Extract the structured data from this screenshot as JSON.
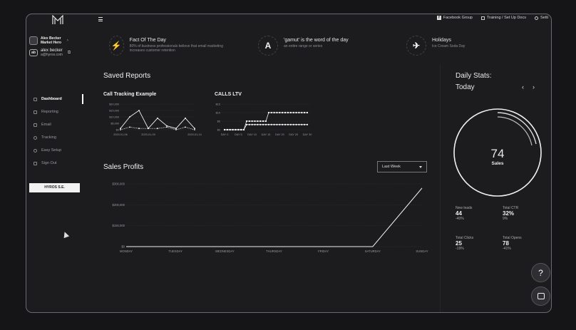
{
  "topbar": {
    "links": [
      {
        "label": "Facebook Group",
        "icon": "facebook-icon"
      },
      {
        "label": "Training / Set Up Docs",
        "icon": "book-icon"
      },
      {
        "label": "Setti",
        "icon": "gear-icon"
      }
    ]
  },
  "sidebar": {
    "account_name_line1": "Alex Becker",
    "account_name_line2": "Market Hero",
    "user_initials": "ab",
    "user_name": "alex becker",
    "user_email": "a@hyros.com",
    "items": [
      {
        "label": "Dashboard",
        "icon": "dashboard-icon",
        "active": true
      },
      {
        "label": "Reporting",
        "icon": "reporting-icon"
      },
      {
        "label": "Email",
        "icon": "email-icon"
      },
      {
        "label": "Tracking",
        "icon": "tracking-icon"
      },
      {
        "label": "Easy Setup",
        "icon": "setup-icon"
      },
      {
        "label": "Sign Out",
        "icon": "signout-icon"
      }
    ],
    "brand_button": "HYROS S.E."
  },
  "facts": [
    {
      "icon": "lightning-icon",
      "glyph": "⚡",
      "title": "Fact Of The Day",
      "desc": "80% of business professionals believe that email marketing increases customer retention"
    },
    {
      "icon": "letter-a-icon",
      "glyph": "A",
      "title": "'gamut' is the word of the day",
      "desc": "an entire range or series"
    },
    {
      "icon": "airplane-icon",
      "glyph": "✈",
      "title": "Holidays",
      "desc": "Ice Cream Soda Day"
    }
  ],
  "saved_reports": {
    "title": "Saved Reports",
    "call_tracking": {
      "title": "Call Tracking Example",
      "chart_data": {
        "type": "line",
        "x": [
          "2020-01-06",
          "2020-01-07",
          "2020-01-08",
          "2020-01-09",
          "2020-01-10",
          "2020-01-11",
          "2020-01-12",
          "2020-01-13",
          "2020-01-14"
        ],
        "x_tick_labels": [
          "2020-01-06",
          "2020-01-09",
          "2020-01-14"
        ],
        "y_tick_labels": [
          "$0",
          "$5,000",
          "$10,000",
          "$15,000",
          "$20,000"
        ],
        "ylim": [
          0,
          20000
        ],
        "series": [
          {
            "values": [
              1000,
              10000,
              15000,
              1000,
              9000,
              3000,
              1000,
              9000,
              1000
            ]
          },
          {
            "values": [
              0,
              2000,
              1000,
              1000,
              1000,
              2000,
              0,
              2000,
              0
            ]
          }
        ]
      }
    },
    "calls_ltv": {
      "title": "CALLS LTV",
      "chart_data": {
        "type": "line",
        "x_tick_labels": [
          "DAY 0",
          "DAY 5",
          "DAY 10",
          "DAY 15",
          "DAY 20",
          "DAY 25",
          "DAY 30"
        ],
        "y_tick_labels": [
          "$0",
          "$5",
          "$10",
          "$15"
        ],
        "ylim": [
          0,
          15
        ],
        "series": [
          {
            "values": [
              0,
              0,
              0,
              0,
              0,
              0,
              0,
              0,
              3,
              3,
              3,
              3,
              3,
              3,
              3,
              3,
              3,
              3,
              3,
              3,
              3,
              3,
              3,
              3,
              3,
              3,
              3,
              3,
              3,
              3,
              3
            ]
          },
          {
            "values": [
              0,
              0,
              0,
              0,
              0,
              0,
              0,
              0,
              5,
              5,
              5,
              5,
              5,
              5,
              5,
              5,
              10,
              10,
              10,
              10,
              10,
              10,
              10,
              10,
              10,
              10,
              10,
              10,
              10,
              10,
              10
            ]
          }
        ]
      }
    }
  },
  "sales_profits": {
    "title": "Sales Profits",
    "period_select": "Last Week",
    "chart_data": {
      "type": "line",
      "categories": [
        "MONDAY",
        "TUESDAY",
        "WEDNESDAY",
        "THURSDAY",
        "FRIDAY",
        "SATURDAY",
        "SUNDAY"
      ],
      "y_tick_labels": [
        "$0",
        "$150,000",
        "$200,000",
        "$300,000"
      ],
      "ylim": [
        0,
        300000
      ],
      "series": [
        {
          "values": [
            0,
            0,
            0,
            0,
            0,
            0,
            280000
          ]
        }
      ]
    }
  },
  "daily_stats": {
    "title": "Daily Stats:",
    "period": "Today",
    "prev": "‹",
    "next": "›",
    "ring_value": "74",
    "ring_label": "Sales",
    "stats": [
      {
        "label": "New leads",
        "value": "44",
        "change": "-40%"
      },
      {
        "label": "Total CTR",
        "value": "32%",
        "change": "9%"
      },
      {
        "label": "Total Clicks",
        "value": "25",
        "change": "-19%"
      },
      {
        "label": "Total Opens",
        "value": "78",
        "change": "-41%"
      }
    ]
  },
  "widgets": {
    "help": "?"
  }
}
